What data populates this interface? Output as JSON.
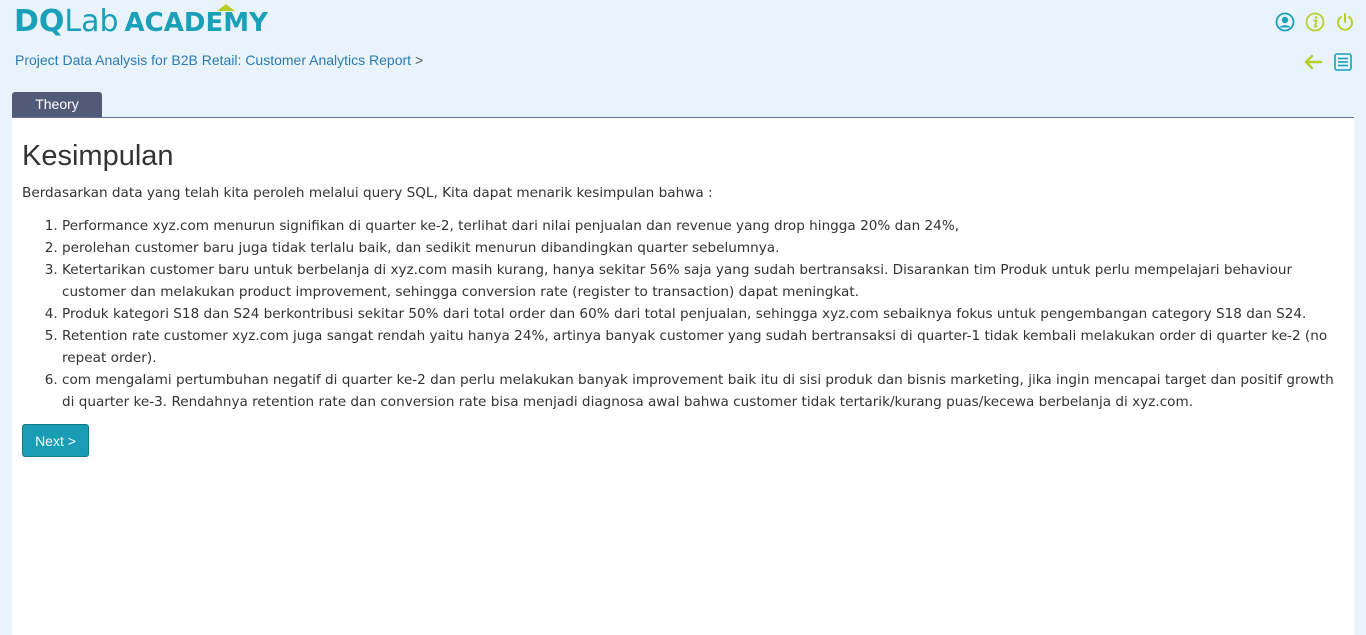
{
  "brand": {
    "logo_part1": "DQ",
    "logo_part2": "Lab",
    "logo_part3": "ACADEMY",
    "primary_color": "#1aa0b8",
    "accent_color": "#b8cf2a"
  },
  "header": {
    "breadcrumb": "Project Data Analysis for B2B Retail: Customer Analytics Report",
    "breadcrumb_sep": ">",
    "icons": [
      "user-icon",
      "info-icon",
      "power-icon",
      "back-arrow-icon",
      "menu-list-icon"
    ]
  },
  "tabs": [
    {
      "label": "Theory",
      "active": true
    }
  ],
  "content": {
    "title": "Kesimpulan",
    "intro": "Berdasarkan data yang telah kita peroleh melalui query SQL, Kita dapat menarik kesimpulan bahwa :",
    "points": [
      "Performance xyz.com menurun signifikan di quarter ke-2, terlihat dari nilai penjualan dan revenue yang drop hingga 20% dan 24%,",
      "perolehan customer baru juga tidak terlalu baik, dan sedikit menurun dibandingkan quarter sebelumnya.",
      "Ketertarikan customer baru untuk berbelanja di xyz.com masih kurang, hanya sekitar 56% saja yang sudah bertransaksi. Disarankan tim Produk untuk perlu mempelajari behaviour customer dan melakukan product improvement, sehingga conversion rate (register to transaction) dapat meningkat.",
      "Produk kategori S18 dan S24 berkontribusi sekitar 50% dari total order dan 60% dari total penjualan, sehingga xyz.com sebaiknya fokus untuk pengembangan category S18 dan S24.",
      "Retention rate customer xyz.com juga sangat rendah yaitu hanya 24%, artinya banyak customer yang sudah bertransaksi di quarter-1 tidak kembali melakukan order di quarter ke-2 (no repeat order).",
      "com mengalami pertumbuhan negatif di quarter ke-2 dan perlu melakukan banyak improvement baik itu di sisi produk dan bisnis marketing, jika ingin mencapai target dan positif growth di quarter ke-3. Rendahnya retention rate dan conversion rate bisa menjadi diagnosa awal bahwa customer tidak tertarik/kurang puas/kecewa berbelanja di xyz.com."
    ],
    "next_label": "Next >"
  }
}
